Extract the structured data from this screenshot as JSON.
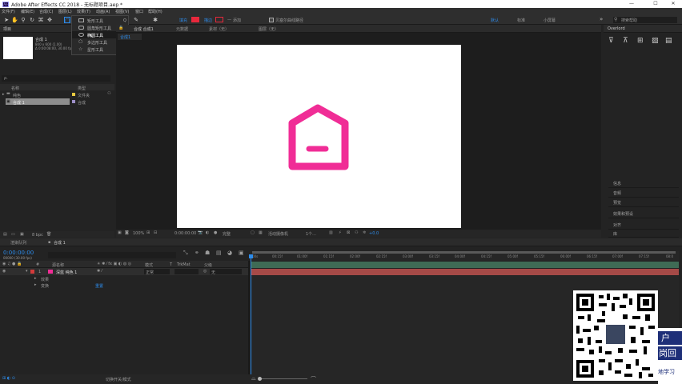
{
  "window": {
    "title": "Adobe After Effects CC 2018 - 无标题项目.aep *",
    "logo": "Ae",
    "minimize": "—",
    "maximize": "☐",
    "close": "✕"
  },
  "menu": [
    "文件(F)",
    "编辑(E)",
    "合成(C)",
    "图层(L)",
    "效果(T)",
    "动画(A)",
    "视图(V)",
    "窗口",
    "帮助(H)"
  ],
  "toolbar": {
    "fill_label": "填充",
    "stroke_label": "描边",
    "stroke_value": "—",
    "add_label": "添加",
    "bezier_label": "贝塞尔曲线路径",
    "workspace": [
      "默认",
      "标准",
      "小屏幕"
    ],
    "search_placeholder": "搜索帮助",
    "colors": {
      "fill": "#e8283c",
      "stroke": "#e8283c",
      "accent": "#2d8ceb"
    }
  },
  "shape_menu": {
    "items": [
      {
        "label": "矩形工具",
        "shortcut": "Q"
      },
      {
        "label": "圆角矩形工具",
        "shortcut": "Q"
      },
      {
        "label": "椭圆工具",
        "shortcut": "Q",
        "selected": true
      },
      {
        "label": "多边形工具",
        "shortcut": "Q"
      },
      {
        "label": "星形工具",
        "shortcut": "Q"
      }
    ]
  },
  "project": {
    "tab": "项目",
    "comp_name": "合成 1",
    "comp_info": [
      "800 x 600 (1.00)",
      "Δ 0:00:08:00, 30.00 fps"
    ],
    "search_placeholder": "ρ.",
    "columns": {
      "name": "名称",
      "type": "类型"
    },
    "rows": [
      {
        "name": "纯色",
        "type": "文件夹"
      },
      {
        "name": "合成 1",
        "type": "合成"
      }
    ],
    "bpc": "8 bpc"
  },
  "viewer": {
    "tabs": [
      "合成 合成1",
      "元数据",
      "素材（无）",
      "图层（无）"
    ],
    "comp_tab": "合成1",
    "zoom": "100%",
    "timecode": "0:00:00:00",
    "quality": "完整",
    "camera": "活动摄像机",
    "views": "1个...",
    "exposure": "+0.0",
    "icon_color": "#f02d96"
  },
  "right_panel": {
    "top_title": "Overlord",
    "items": [
      "信息",
      "音频",
      "预览",
      "效果和预设",
      "对齐",
      "库",
      "段落",
      "字符"
    ]
  },
  "timeline": {
    "tabs": [
      "渲染队列",
      "合成 1"
    ],
    "timecode": "0:00:00:00",
    "frame_info": "00000 (30.00 fps)",
    "columns": {
      "source": "源名称",
      "mode": "模式",
      "trkmat": "TrkMat",
      "parent": "父级"
    },
    "layer": {
      "index": "1",
      "name": "深蓝 纯色 1",
      "mode": "正常",
      "parent": "无",
      "color": "#d33b3b"
    },
    "sublabels": [
      "效果",
      "变换"
    ],
    "reset": "重置",
    "ruler_ticks": [
      "00s",
      "00:15f",
      "01:00f",
      "01:15f",
      "02:00f",
      "02:15f",
      "03:00f",
      "03:15f",
      "04:00f",
      "04:15f",
      "05:00f",
      "05:15f",
      "06:00f",
      "06:15f",
      "07:00f",
      "07:15f",
      "08:0"
    ],
    "bottom_toggle": "切换开关/模式"
  },
  "watermark": {
    "lines": [
      "户",
      "岗回",
      "地学习"
    ]
  }
}
